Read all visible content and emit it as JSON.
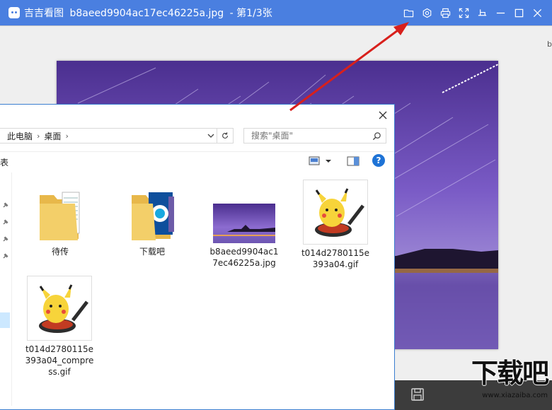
{
  "viewer": {
    "app_name": "吉吉看图",
    "file_name": "b8aeed9904ac17ec46225a.jpg",
    "page_info": "- 第1/3张",
    "right_stub_text": "b"
  },
  "explorer": {
    "breadcrumb": [
      "此电脑",
      "桌面"
    ],
    "search_placeholder": "搜索\"桌面\"",
    "cmd_left_text": "表",
    "help_label": "?",
    "files": [
      {
        "name": "待传",
        "type": "folder"
      },
      {
        "name": "下载吧",
        "type": "folder-with-image"
      },
      {
        "name": "b8aeed9904ac17ec46225a.jpg",
        "type": "image"
      },
      {
        "name": "t014d2780115e393a04.gif",
        "type": "gif"
      },
      {
        "name": "t014d2780115e393a04_compress.gif",
        "type": "gif"
      }
    ]
  },
  "watermark": {
    "main": "下载吧",
    "url": "www.xiazaiba.com"
  },
  "colors": {
    "titlebar": "#4a7fe0",
    "photo_sky": "#6a4bb0",
    "arrow": "#d8201c",
    "folder": "#f3cf69"
  }
}
